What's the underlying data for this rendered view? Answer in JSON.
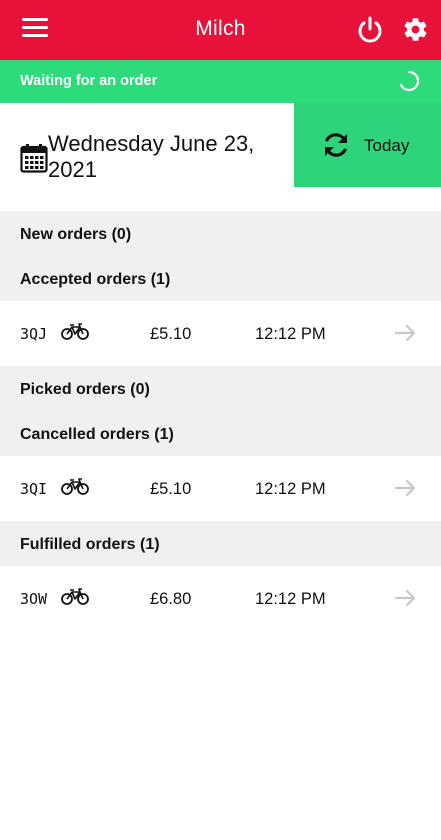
{
  "app": {
    "title": "Milch",
    "menu_icon": "menu-icon",
    "power_icon": "power-icon",
    "settings_icon": "gear-icon",
    "colors": {
      "header": "#e8113a",
      "status": "#2ddb7a",
      "today": "#2ed47c",
      "section_bg": "#f0f0f2"
    }
  },
  "status": {
    "text": "Waiting for an order",
    "icon": "spinner-icon"
  },
  "date": {
    "text": "Wednesday June 23, 2021",
    "icon": "calendar-icon"
  },
  "today_button": {
    "label": "Today",
    "icon": "refresh-icon"
  },
  "sections": [
    {
      "label": "New orders (0)",
      "orders": []
    },
    {
      "label": "Accepted orders (1)",
      "orders": [
        {
          "code": "3QJ",
          "icon": "bicycle-icon",
          "price": "£5.10",
          "time": "12:12 PM"
        }
      ]
    },
    {
      "label": "Picked orders (0)",
      "orders": []
    },
    {
      "label": "Cancelled orders (1)",
      "orders": [
        {
          "code": "3QI",
          "icon": "bicycle-icon",
          "price": "£5.10",
          "time": "12:12 PM"
        }
      ]
    },
    {
      "label": "Fulfilled orders (1)",
      "orders": [
        {
          "code": "3OW",
          "icon": "bicycle-icon",
          "price": "£6.80",
          "time": "12:12 PM"
        }
      ]
    }
  ]
}
